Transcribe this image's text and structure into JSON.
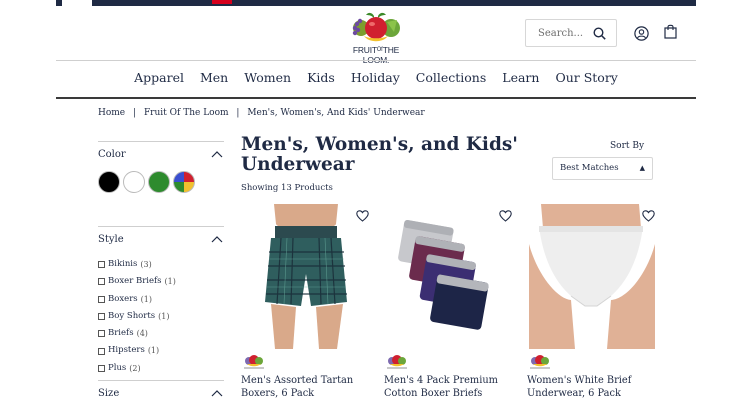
{
  "header": {
    "logo_text": "FRUITᴼᶠTHE LOOM.",
    "search": {
      "placeholder": "Search..."
    }
  },
  "nav": {
    "items": [
      {
        "label": "Apparel"
      },
      {
        "label": "Men"
      },
      {
        "label": "Women"
      },
      {
        "label": "Kids"
      },
      {
        "label": "Holiday"
      },
      {
        "label": "Collections"
      },
      {
        "label": "Learn"
      },
      {
        "label": "Our Story"
      }
    ]
  },
  "breadcrumb": {
    "items": [
      "Home",
      "|",
      "Fruit Of The Loom",
      "|",
      "Men's, Women's, And Kids' Underwear"
    ]
  },
  "filters": {
    "color": {
      "title": "Color",
      "swatches": [
        "#000000",
        "#ffffff",
        "#2e8b2e",
        "multicolor"
      ]
    },
    "style": {
      "title": "Style",
      "options": [
        {
          "label": "Bikinis",
          "count": "(3)"
        },
        {
          "label": "Boxer Briefs",
          "count": "(1)"
        },
        {
          "label": "Boxers",
          "count": "(1)"
        },
        {
          "label": "Boy Shorts",
          "count": "(1)"
        },
        {
          "label": "Briefs",
          "count": "(4)"
        },
        {
          "label": "Hipsters",
          "count": "(1)"
        },
        {
          "label": "Plus",
          "count": "(2)"
        }
      ]
    },
    "size": {
      "title": "Size"
    }
  },
  "listing": {
    "title": "Men's, Women's, and Kids' Underwear",
    "showing": "Showing 13 Products",
    "sort_label": "Sort By",
    "sort_value": "Best Matches"
  },
  "products": [
    {
      "name": "Men's Assorted Tartan Boxers, 6 Pack"
    },
    {
      "name": "Men's 4 Pack Premium Cotton Boxer Briefs"
    },
    {
      "name": "Women's White Brief Underwear, 6 Pack"
    }
  ],
  "colors": {
    "navy": "#1f2a44",
    "accent_red": "#d6001c"
  }
}
